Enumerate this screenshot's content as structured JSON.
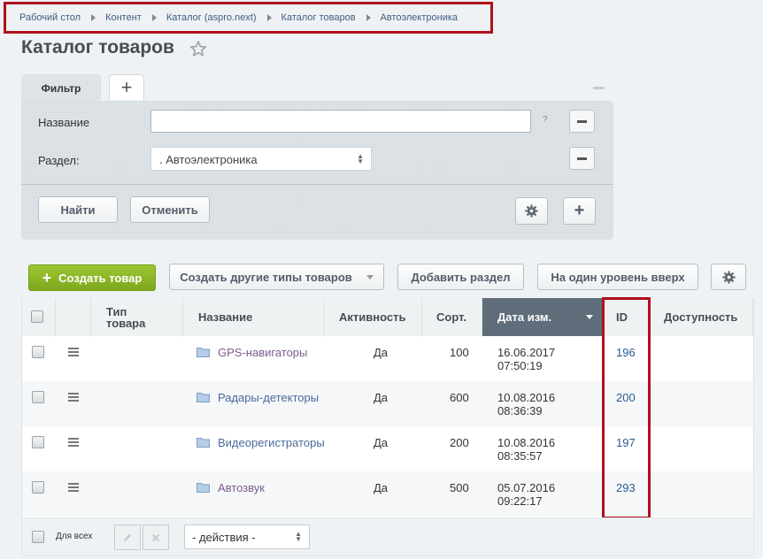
{
  "breadcrumb": [
    "Рабочий стол",
    "Контент",
    "Каталог (aspro.next)",
    "Каталог товаров",
    "Автоэлектроника"
  ],
  "page": {
    "title": "Каталог товаров"
  },
  "filter": {
    "tab_label": "Фильтр",
    "add_tab_label": "+",
    "fields": {
      "name_label": "Название",
      "name_value": "",
      "name_help": "?",
      "section_label": "Раздел:",
      "section_value": ". Автоэлектроника"
    },
    "find_label": "Найти",
    "cancel_label": "Отменить",
    "add_condition_label": "+"
  },
  "toolbar": {
    "create_label": "Создать товар",
    "create_plus": "+",
    "create_other_label": "Создать другие типы товаров",
    "add_section_label": "Добавить раздел",
    "level_up_label": "На один уровень вверх"
  },
  "table": {
    "headers": {
      "type": "Тип товара",
      "name": "Название",
      "active": "Активность",
      "sort": "Сорт.",
      "date": "Дата изм.",
      "id": "ID",
      "availability": "Доступность"
    },
    "rows": [
      {
        "name": "GPS-навигаторы",
        "active": "Да",
        "sort": "100",
        "date": "16.06.2017",
        "time": "07:50:19",
        "id": "196",
        "visited": true
      },
      {
        "name": "Радары-детекторы",
        "active": "Да",
        "sort": "600",
        "date": "10.08.2016",
        "time": "08:36:39",
        "id": "200",
        "visited": false
      },
      {
        "name": "Видеорегистраторы",
        "active": "Да",
        "sort": "200",
        "date": "10.08.2016",
        "time": "08:35:57",
        "id": "197",
        "visited": false
      },
      {
        "name": "Автозвук",
        "active": "Да",
        "sort": "500",
        "date": "05.07.2016",
        "time": "09:22:17",
        "id": "293",
        "visited": true
      }
    ]
  },
  "footer": {
    "for_all_label": "Для всех",
    "action_select_value": "- действия -"
  },
  "colors": {
    "accent_green": "#8cb62a",
    "highlight_red": "#b0101c",
    "active_header": "#5f6d7a"
  }
}
